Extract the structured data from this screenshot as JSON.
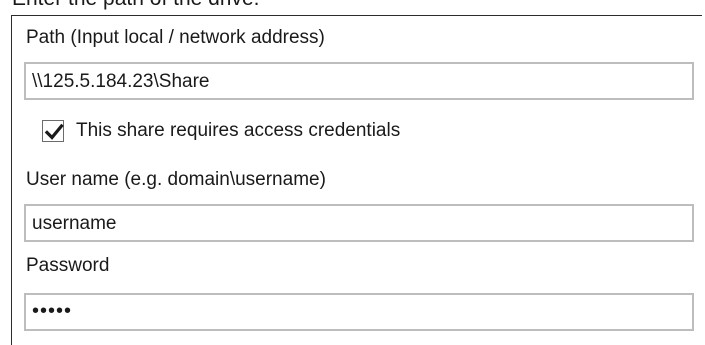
{
  "heading": "Enter the path of the drive.",
  "path": {
    "label": "Path (Input local / network address)",
    "value": "\\\\125.5.184.23\\Share"
  },
  "credentials_checkbox": {
    "label": "This share requires access credentials",
    "checked": true
  },
  "username": {
    "label": "User name (e.g. domain\\username)",
    "value": "username"
  },
  "password": {
    "label": "Password",
    "masked_value": "•••••"
  }
}
